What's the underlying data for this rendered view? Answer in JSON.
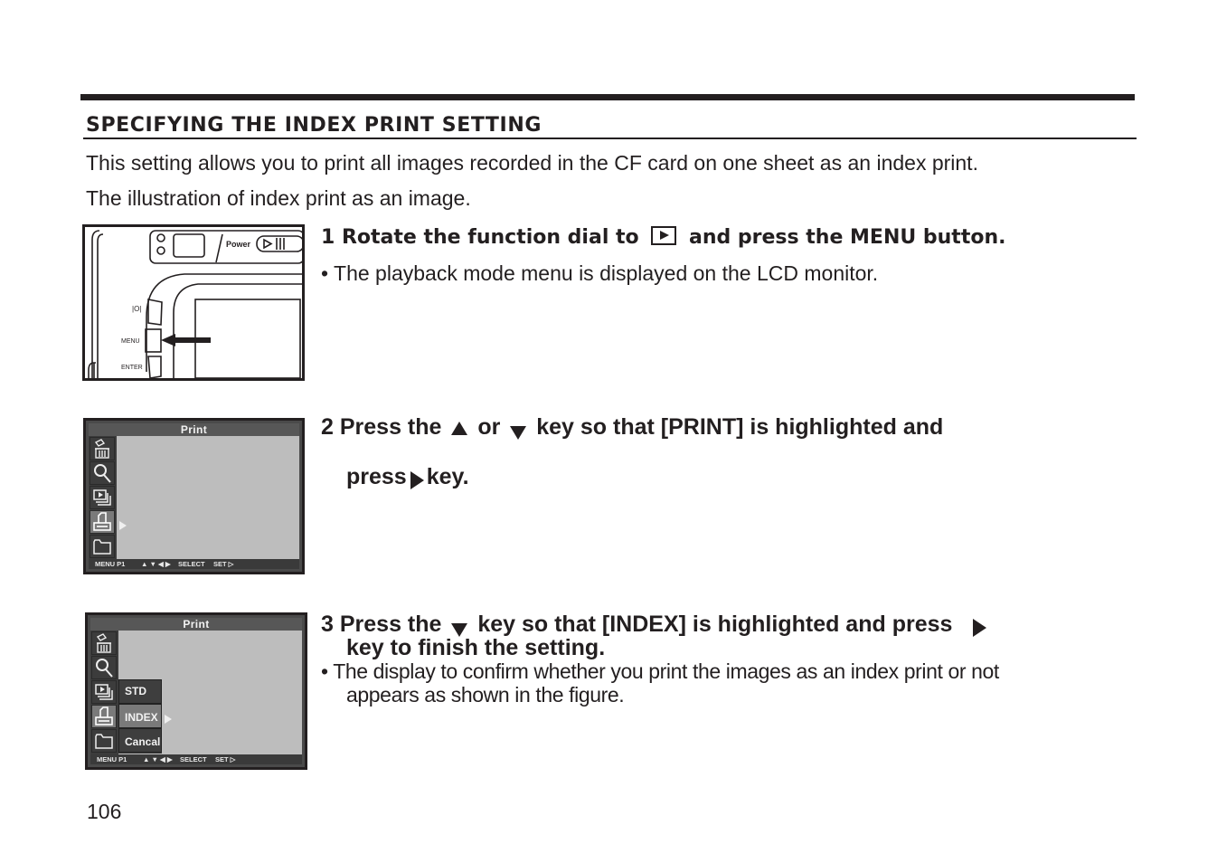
{
  "section": {
    "title": "SPECIFYING THE INDEX PRINT SETTING",
    "intro_line_1": "This setting allows you to print all images recorded in the CF card on one sheet as an index print.",
    "intro_line_2": "The illustration of index print as an image."
  },
  "steps": [
    {
      "number": "1",
      "heading_part_1": "Rotate the function dial to",
      "heading_icon": "playback-mode-icon",
      "heading_part_2": "and press the MENU button.",
      "bullet": "• The playback mode menu is displayed on the LCD monitor.",
      "figure": {
        "type": "camera-back-illustration",
        "labels": {
          "power": "Power",
          "display_button": "|O|",
          "menu_button": "MENU",
          "enter_button": "ENTER"
        }
      }
    },
    {
      "number": "2",
      "heading_part_1": "Press the",
      "heading_icon_1": "up-arrow-icon",
      "heading_part_2": "or",
      "heading_icon_2": "down-arrow-icon",
      "heading_part_3": "key so that [PRINT] is highlighted and",
      "heading_line_2_part_1": "press",
      "heading_line_2_icon": "right-arrow-icon",
      "heading_line_2_part_2": "key.",
      "figure": {
        "type": "lcd-menu",
        "title": "Print",
        "menu_icons": [
          "delete-icon",
          "magnify-icon",
          "slideshow-icon",
          "print-icon",
          "folder-icon"
        ],
        "selected_icon": "print-icon",
        "footer": {
          "page": "MENU P1",
          "arrows": "▲ ▼ ◀ ▶",
          "select": "SELECT",
          "set": "SET ▷"
        }
      }
    },
    {
      "number": "3",
      "heading_part_1": "Press the",
      "heading_icon_1": "down-arrow-icon",
      "heading_part_2": "key so that [INDEX] is highlighted and press",
      "heading_icon_2": "right-arrow-icon",
      "heading_line_2": "key to finish the setting.",
      "bullet_line_1": "• The display to confirm whether you print the images as an index print or not",
      "bullet_line_2": "appears as shown in the figure.",
      "figure": {
        "type": "lcd-menu",
        "title": "Print",
        "menu_icons": [
          "delete-icon",
          "magnify-icon",
          "slideshow-icon",
          "print-icon",
          "folder-icon"
        ],
        "selected_icon": "print-icon",
        "submenu": [
          "STD",
          "INDEX",
          "Cancal"
        ],
        "selected_submenu": "INDEX",
        "footer": {
          "page": "MENU P1",
          "arrows": "▲ ▼ ◀ ▶",
          "select": "SELECT",
          "set": "SET ▷"
        }
      }
    }
  ],
  "page_number": "106"
}
